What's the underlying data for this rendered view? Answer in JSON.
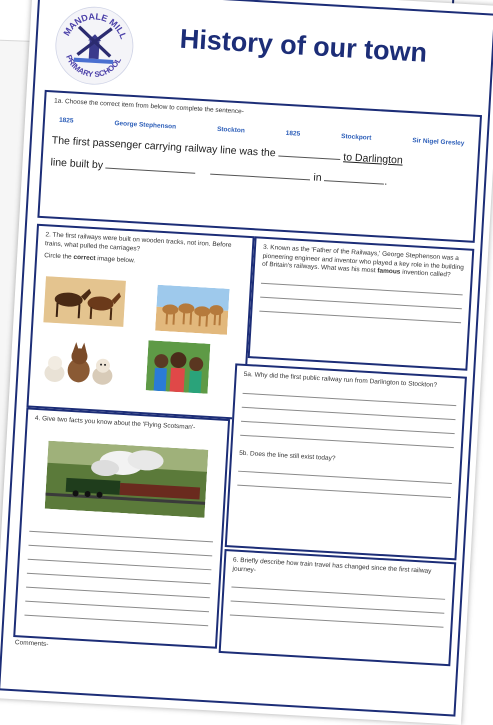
{
  "school": {
    "name_top": "MANDALE MILL",
    "name_bottom": "PRIMARY SCHOOL"
  },
  "title": "History of our town",
  "q1a": {
    "prompt": "1a. Choose the correct item from below to complete the sentence-",
    "options": [
      "1825",
      "George Stephenson",
      "Stockton",
      "1825",
      "Stockport",
      "Sir Nigel Gresley"
    ],
    "sentence_part1": "The first passenger carrying railway line was the",
    "sentence_part2": "to Darlington",
    "sentence_part3": "line built by",
    "sentence_part4": "in",
    "sentence_end": "."
  },
  "q2": {
    "text": "2. The first railways were built on wooden tracks, not iron. Before trains, what pulled the carriages?",
    "circle_prefix": "Circle the",
    "circle_bold": "correct",
    "circle_suffix": "image below."
  },
  "q3": {
    "text": "3. Known as the 'Father of the Railways,' George Stephenson was a pioneering engineer and inventor who played a key role in the building of Britain's railways. What was his most",
    "bold": "famous",
    "suffix": "invention called?"
  },
  "q4": {
    "text": "4. Give two facts you know about the 'Flying Scotsman'-"
  },
  "q5a": {
    "text": "5a. Why did the first public railway run from Darlington to Stockton?"
  },
  "q5b": {
    "text": "5b. Does the line still exist today?"
  },
  "q6": {
    "text": "6. Briefly describe how train travel has changed since the first railway journey-"
  },
  "comments": {
    "label": "Comments-"
  }
}
